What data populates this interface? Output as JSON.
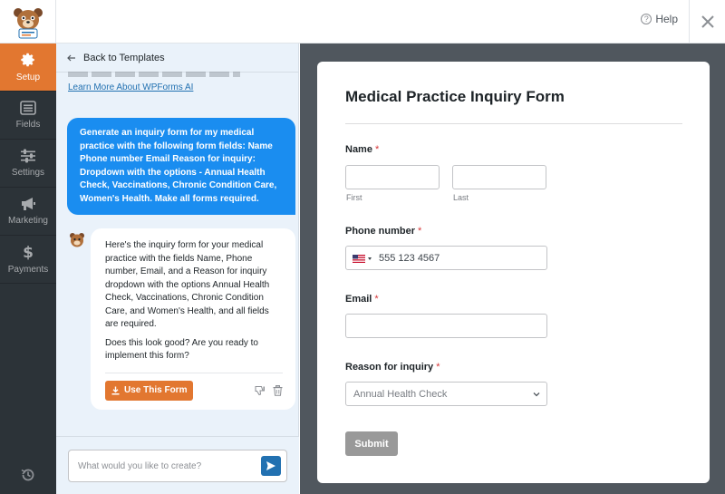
{
  "header": {
    "help_label": "Help"
  },
  "sidebar": {
    "items": [
      {
        "label": "Setup",
        "icon": "gear-icon"
      },
      {
        "label": "Fields",
        "icon": "list-icon"
      },
      {
        "label": "Settings",
        "icon": "sliders-icon"
      },
      {
        "label": "Marketing",
        "icon": "megaphone-icon"
      },
      {
        "label": "Payments",
        "icon": "dollar-icon"
      }
    ],
    "history_icon": "history-icon"
  },
  "chat": {
    "back_label": "Back to Templates",
    "learn_more": "Learn More About WPForms AI",
    "user_message": "Generate an inquiry form for my medical practice with the following form fields: Name Phone number Email Reason for inquiry: Dropdown with the options - Annual Health Check, Vaccinations, Chronic Condition Care, Women's Health. Make all forms required.",
    "ai_message": "Here's the inquiry form for your medical practice with the fields Name, Phone number, Email, and a Reason for inquiry dropdown with the options Annual Health Check, Vaccinations, Chronic Condition Care, and Women's Health, and all fields are required.",
    "ai_question": "Does this look good? Are you ready to implement this form?",
    "use_button": "Use This Form",
    "input_placeholder": "What would you like to create?"
  },
  "form": {
    "title": "Medical Practice Inquiry Form",
    "name_label": "Name",
    "first_label": "First",
    "last_label": "Last",
    "phone_label": "Phone number",
    "phone_value": "555 123 4567",
    "email_label": "Email",
    "reason_label": "Reason for inquiry",
    "reason_selected": "Annual Health Check",
    "required_mark": "*",
    "submit_label": "Submit"
  },
  "colors": {
    "accent": "#e27730",
    "user_bubble": "#1a8df0",
    "sidebar_bg": "#2c3338",
    "preview_bg": "#50575e",
    "chat_bg": "#eaf2fa",
    "required": "#d63638",
    "submit_bg": "#999999"
  }
}
